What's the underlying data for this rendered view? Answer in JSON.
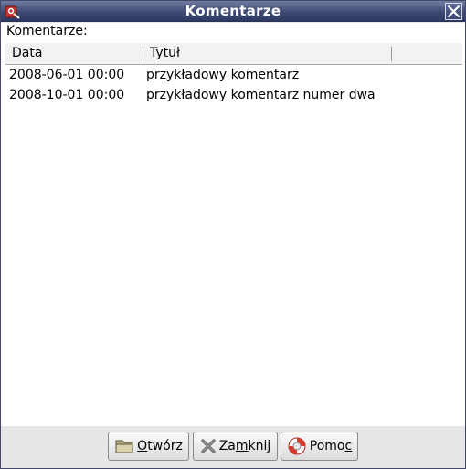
{
  "window": {
    "title": "Komentarze"
  },
  "section": {
    "label": "Komentarze:"
  },
  "list": {
    "columns": [
      "Data",
      "Tytuł"
    ],
    "rows": [
      {
        "date": "2008-06-01 00:00",
        "title": "przykładowy komentarz"
      },
      {
        "date": "2008-10-01 00:00",
        "title": "przykładowy komentarz numer dwa"
      }
    ]
  },
  "buttons": {
    "open": {
      "mnemonic": "O",
      "rest": "twórz",
      "icon": "folder-icon"
    },
    "close": {
      "before": "Za",
      "mnemonic": "m",
      "after": "knij",
      "icon": "close-x-icon"
    },
    "help": {
      "before": "Pomo",
      "mnemonic": "c",
      "icon": "lifebuoy-icon"
    }
  },
  "colors": {
    "titlebar": "#3f4b73",
    "title_text": "#ffffff",
    "button_bar": "#e6e6e6"
  }
}
